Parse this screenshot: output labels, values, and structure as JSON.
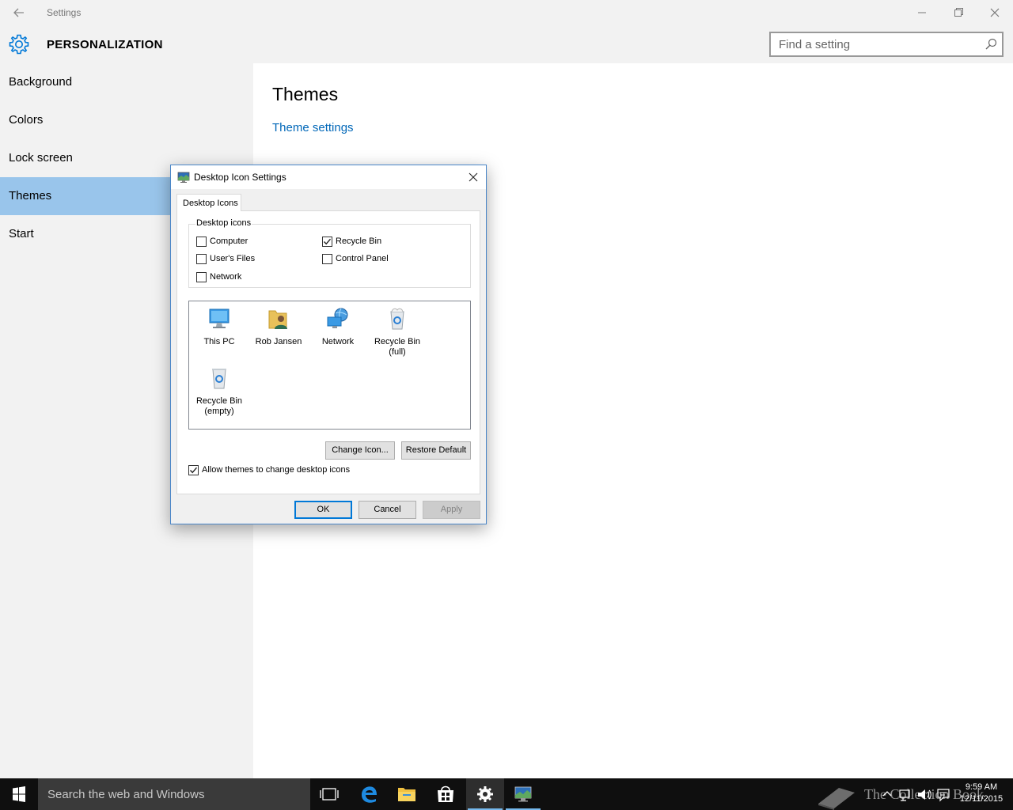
{
  "window": {
    "app_title": "Settings",
    "back_icon": "back-arrow-icon",
    "minimize_icon": "minimize-icon",
    "restore_icon": "restore-icon",
    "close_icon": "close-icon"
  },
  "header": {
    "title": "PERSONALIZATION",
    "icon": "gear-icon",
    "search_placeholder": "Find a setting"
  },
  "sidebar": {
    "items": [
      {
        "label": "Background"
      },
      {
        "label": "Colors"
      },
      {
        "label": "Lock screen"
      },
      {
        "label": "Themes",
        "active": true
      },
      {
        "label": "Start"
      }
    ]
  },
  "content": {
    "title": "Themes",
    "link": "Theme settings"
  },
  "dialog": {
    "title": "Desktop Icon Settings",
    "tab": "Desktop Icons",
    "group_label": "Desktop icons",
    "checkboxes": [
      {
        "label": "Computer",
        "checked": false
      },
      {
        "label": "Recycle Bin",
        "checked": true
      },
      {
        "label": "User's Files",
        "checked": false
      },
      {
        "label": "Control Panel",
        "checked": false
      },
      {
        "label": "Network",
        "checked": false
      }
    ],
    "icons": [
      {
        "label": "This PC",
        "icon": "this-pc-icon"
      },
      {
        "label": "Rob Jansen",
        "icon": "user-folder-icon"
      },
      {
        "label": "Network",
        "icon": "network-icon"
      },
      {
        "label": "Recycle Bin (full)",
        "icon": "recycle-bin-full-icon"
      },
      {
        "label": "Recycle Bin (empty)",
        "icon": "recycle-bin-empty-icon"
      }
    ],
    "change_icon_button": "Change Icon...",
    "restore_default_button": "Restore Default",
    "allow_themes": {
      "label": "Allow themes to change desktop icons",
      "checked": true
    },
    "ok_button": "OK",
    "cancel_button": "Cancel",
    "apply_button": "Apply"
  },
  "taskbar": {
    "search_text": "Search the web and Windows",
    "apps": [
      "task-view-icon",
      "edge-icon",
      "file-explorer-icon",
      "store-icon",
      "settings-icon",
      "desktop-icon-settings-icon"
    ],
    "time": "9:59 AM",
    "date": "12/11/2015",
    "watermark": "The Collection Book"
  },
  "colors": {
    "accent": "#0078d7",
    "nav_active": "#99c5eb",
    "link": "#0067b8",
    "taskbar": "#0f0f0f"
  }
}
